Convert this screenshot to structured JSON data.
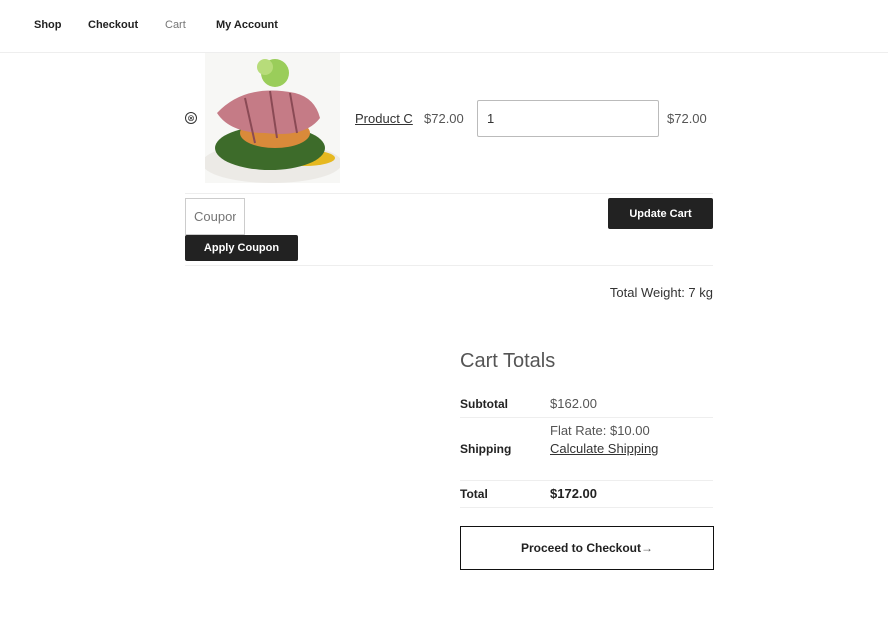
{
  "nav": {
    "items": [
      {
        "label": "Shop",
        "current": false
      },
      {
        "label": "Checkout",
        "current": false
      },
      {
        "label": "Cart",
        "current": true
      },
      {
        "label": "My Account",
        "current": false
      }
    ]
  },
  "cart": {
    "item": {
      "remove_glyph": "⊗",
      "name": "Product C",
      "price": "$72.00",
      "quantity": "1",
      "subtotal": "$72.00"
    },
    "coupon_placeholder": "Coupon code",
    "apply_coupon_label": "Apply Coupon",
    "update_cart_label": "Update Cart",
    "total_weight": "Total Weight: 7 kg"
  },
  "totals": {
    "title": "Cart Totals",
    "subtotal_label": "Subtotal",
    "subtotal_value": "$162.00",
    "shipping_label": "Shipping",
    "shipping_method": "Flat Rate: $10.00",
    "calculate_shipping_label": "Calculate Shipping",
    "total_label": "Total",
    "total_value": "$172.00",
    "checkout_label": "Proceed to Checkout",
    "checkout_arrow": "→"
  }
}
